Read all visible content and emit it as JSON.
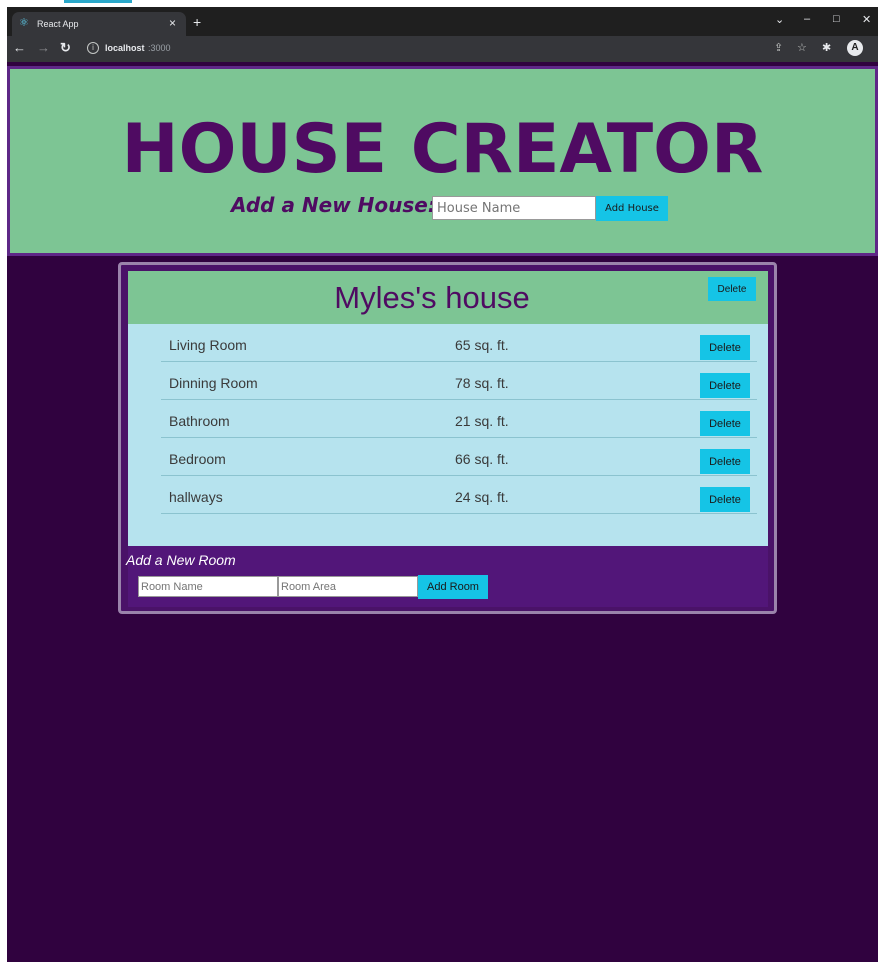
{
  "browser": {
    "tab_title": "React App",
    "tab_close": "×",
    "new_tab": "+",
    "url_host": "localhost",
    "url_port": ":3000",
    "win_min": "–",
    "win_max": "□",
    "win_close": "✕",
    "tab_search": "⌄"
  },
  "header": {
    "title": "HOUSE CREATOR",
    "add_label": "Add a New House:",
    "house_input_placeholder": "House Name",
    "add_button": "Add House"
  },
  "house": {
    "name": "Myles's house",
    "delete_label": "Delete",
    "rooms": [
      {
        "name": "Living Room",
        "area": "65 sq. ft.",
        "delete": "Delete"
      },
      {
        "name": "Dinning Room",
        "area": "78 sq. ft.",
        "delete": "Delete"
      },
      {
        "name": "Bathroom",
        "area": "21 sq. ft.",
        "delete": "Delete"
      },
      {
        "name": "Bedroom",
        "area": "66 sq. ft.",
        "delete": "Delete"
      },
      {
        "name": "hallways",
        "area": "24 sq. ft.",
        "delete": "Delete"
      }
    ],
    "new_room": {
      "label": "Add a New Room",
      "name_placeholder": "Room Name",
      "area_placeholder": "Room Area",
      "add_button": "Add Room"
    }
  },
  "colors": {
    "page_background": "#30023f",
    "header_background": "#7dc594",
    "title_color": "#4f0b62",
    "button_color": "#15c4e6",
    "rooms_background": "#b6e3ee",
    "new_room_background": "#521679"
  }
}
